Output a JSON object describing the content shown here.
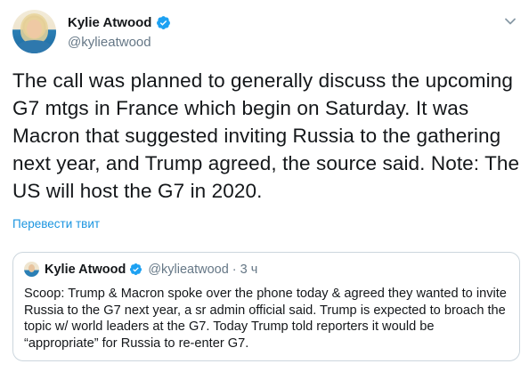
{
  "author": {
    "name": "Kylie Atwood",
    "handle": "@kylieatwood",
    "verified": true
  },
  "icons": {
    "avatar": "avatar-photo",
    "verified": "verified-badge-icon",
    "menu": "chevron-down-icon"
  },
  "colors": {
    "link": "#1b95e0",
    "verified": "#1da1f2",
    "secondary_text": "#657786",
    "border": "#ccd6dd"
  },
  "tweet": {
    "text": "The call was planned to generally discuss the upcoming G7 mtgs in France which begin on Saturday. It was Macron that suggested inviting Russia to the gathering next year, and Trump agreed, the source said. Note: The US will host the G7 in 2020.",
    "translate_label": "Перевести твит"
  },
  "quoted_tweet": {
    "name": "Kylie Atwood",
    "handle": "@kylieatwood",
    "separator": "·",
    "time": "3 ч",
    "text": "Scoop: Trump & Macron spoke over the phone today & agreed they wanted to invite Russia to the G7 next year, a sr admin official said. Trump is expected to broach the topic w/ world leaders at the G7. Today Trump told reporters it would be “appropriate” for Russia to re-enter G7."
  }
}
